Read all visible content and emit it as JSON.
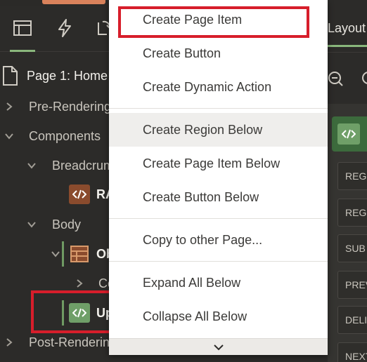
{
  "tree": {
    "page_title": "Page 1: Home",
    "items": [
      {
        "label": "Pre-Rendering"
      },
      {
        "label": "Components"
      },
      {
        "label": "Breadcrum"
      },
      {
        "label": "RA"
      },
      {
        "label": "Body"
      },
      {
        "label": "Ob"
      },
      {
        "label": "Co"
      },
      {
        "label": "Up"
      },
      {
        "label": "Post-Renderin"
      }
    ]
  },
  "right_panel": {
    "tab_label": "Layout",
    "buttons": [
      "REGI",
      "REGI",
      "SUB",
      "PREV",
      "DELI",
      "NEXT"
    ]
  },
  "menu": {
    "items": [
      {
        "label": "Create Page Item"
      },
      {
        "label": "Create Button"
      },
      {
        "label": "Create Dynamic Action"
      },
      {
        "label": "Create Region Below"
      },
      {
        "label": "Create Page Item Below"
      },
      {
        "label": "Create Button Below"
      },
      {
        "label": "Copy to other Page..."
      },
      {
        "label": "Expand All Below"
      },
      {
        "label": "Collapse All Below"
      }
    ]
  },
  "colors": {
    "highlight_box": "#d71e2b",
    "accent_green": "#8ab77c",
    "code_brown": "#8a4b2d",
    "code_green": "#6f9f68"
  }
}
